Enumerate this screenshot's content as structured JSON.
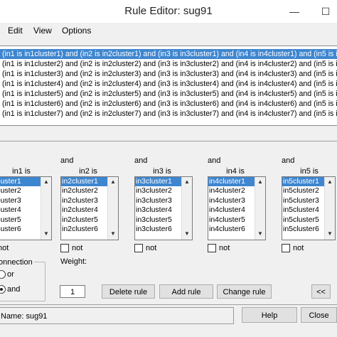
{
  "window": {
    "title": "Rule Editor: sug91",
    "minimize_glyph": "—",
    "maximize_glyph": "☐"
  },
  "menu": [
    "Edit",
    "View",
    "Options"
  ],
  "rules": [
    "(in1 is in1cluster1) and (in2 is in2cluster1) and (in3 is in3cluster1) and (in4 is in4cluster1) and (in5 is in5cluster1) and (in",
    "(in1 is in1cluster2) and (in2 is in2cluster2) and (in3 is in3cluster2) and (in4 is in4cluster2) and (in5 is in5cluster2) and (in",
    "(in1 is in1cluster3) and (in2 is in2cluster3) and (in3 is in3cluster3) and (in4 is in4cluster3) and (in5 is in5cluster3) and (in",
    "(in1 is in1cluster4) and (in2 is in2cluster4) and (in3 is in3cluster4) and (in4 is in4cluster4) and (in5 is in5cluster4) and (in",
    "(in1 is in1cluster5) and (in2 is in2cluster5) and (in3 is in3cluster5) and (in4 is in4cluster5) and (in5 is in5cluster5) and (in",
    "(in1 is in1cluster6) and (in2 is in2cluster6) and (in3 is in3cluster6) and (in4 is in4cluster6) and (in5 is in5cluster6) and (in",
    "(in1 is in1cluster7) and (in2 is in2cluster7) and (in3 is in3cluster7) and (in4 is in4cluster7) and (in5 is in5cluster7) and (in"
  ],
  "inputs": [
    {
      "and_label": "",
      "var_label": "in1 is",
      "items": [
        "cluster1",
        "cluster2",
        "cluster3",
        "cluster4",
        "cluster5",
        "cluster6"
      ],
      "not_label": "not"
    },
    {
      "and_label": "and",
      "var_label": "in2 is",
      "items": [
        "in2cluster1",
        "in2cluster2",
        "in2cluster3",
        "in2cluster4",
        "in2cluster5",
        "in2cluster6"
      ],
      "not_label": "not"
    },
    {
      "and_label": "and",
      "var_label": "in3 is",
      "items": [
        "in3cluster1",
        "in3cluster2",
        "in3cluster3",
        "in3cluster4",
        "in3cluster5",
        "in3cluster6"
      ],
      "not_label": "not"
    },
    {
      "and_label": "and",
      "var_label": "in4 is",
      "items": [
        "in4cluster1",
        "in4cluster2",
        "in4cluster3",
        "in4cluster4",
        "in4cluster5",
        "in4cluster6"
      ],
      "not_label": "not"
    },
    {
      "and_label": "and",
      "var_label": "in5 is",
      "items": [
        "in5cluster1",
        "in5cluster2",
        "in5cluster3",
        "in5cluster4",
        "in5cluster5",
        "in5cluster6"
      ],
      "not_label": "not"
    }
  ],
  "connection": {
    "title": "onnection",
    "or_label": "or",
    "and_label": "and",
    "selected": "and"
  },
  "weight": {
    "label": "Weight:",
    "value": "1"
  },
  "buttons": {
    "delete": "Delete rule",
    "add": "Add rule",
    "change": "Change rule",
    "prev": "<<",
    "help": "Help",
    "close": "Close"
  },
  "status_text": "Name: sug91"
}
